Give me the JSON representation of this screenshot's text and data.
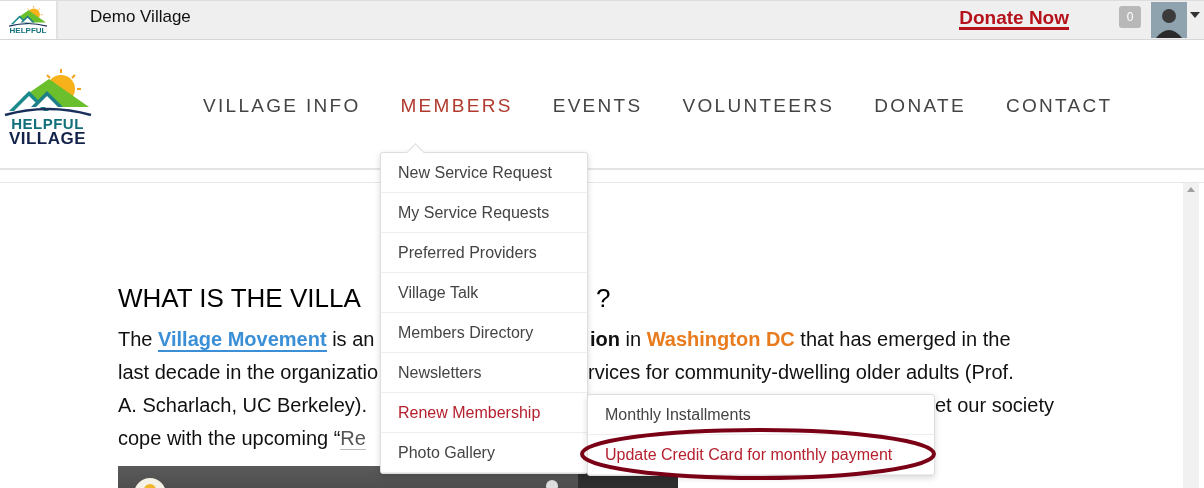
{
  "top_bar": {
    "logo_text": "HELPFUL",
    "site_name": "Demo Village",
    "donate_link": "Donate Now",
    "notification_count": "0"
  },
  "header": {
    "logo_lines": [
      "HELPFUL",
      "VILLAGE"
    ],
    "nav": [
      {
        "label": "VILLAGE INFO",
        "selected": false
      },
      {
        "label": "MEMBERS",
        "selected": true
      },
      {
        "label": "EVENTS",
        "selected": false
      },
      {
        "label": "VOLUNTEERS",
        "selected": false
      },
      {
        "label": "DONATE",
        "selected": false
      },
      {
        "label": "CONTACT",
        "selected": false
      }
    ]
  },
  "members_menu": [
    {
      "label": "New Service Request",
      "highlighted": false
    },
    {
      "label": "My Service Requests",
      "highlighted": false
    },
    {
      "label": "Preferred Providers",
      "highlighted": false
    },
    {
      "label": "Village Talk",
      "highlighted": false
    },
    {
      "label": "Members Directory",
      "highlighted": false
    },
    {
      "label": "Newsletters",
      "highlighted": false
    },
    {
      "label": "Renew Membership",
      "highlighted": true
    },
    {
      "label": "Photo Gallery",
      "highlighted": false
    }
  ],
  "submenu": [
    {
      "label": "Monthly Installments",
      "highlighted": false,
      "circled": false
    },
    {
      "label": "Update Credit Card for monthly payment",
      "highlighted": true,
      "circled": true
    }
  ],
  "content": {
    "heading": [
      "WHAT IS THE VILLA",
      "?"
    ],
    "lines": [
      {
        "left": [
          {
            "kind": "text",
            "text": "The "
          },
          {
            "kind": "link",
            "text": "Village Movement"
          },
          {
            "kind": "text",
            "text": " is an"
          }
        ],
        "right": [
          {
            "kind": "bold",
            "text": "ion"
          },
          {
            "kind": "text",
            "text": " in "
          },
          {
            "kind": "highlight",
            "text": "Washington DC"
          },
          {
            "kind": "text",
            "text": " that has emerged in the"
          }
        ]
      },
      {
        "left": [
          {
            "kind": "text",
            "text": "last decade in the organizatio"
          }
        ],
        "right": [
          {
            "kind": "text",
            "text": "rvices for community-dwelling older adults (Prof."
          }
        ]
      },
      {
        "left": [
          {
            "kind": "text",
            "text": "A. Scharlach, UC Berkeley)."
          }
        ],
        "right": [
          {
            "kind": "text",
            "text": "et our society"
          }
        ]
      },
      {
        "left": [
          {
            "kind": "text",
            "text": "cope with the upcoming “"
          },
          {
            "kind": "subtle_link",
            "text": "Re"
          }
        ]
      }
    ]
  }
}
